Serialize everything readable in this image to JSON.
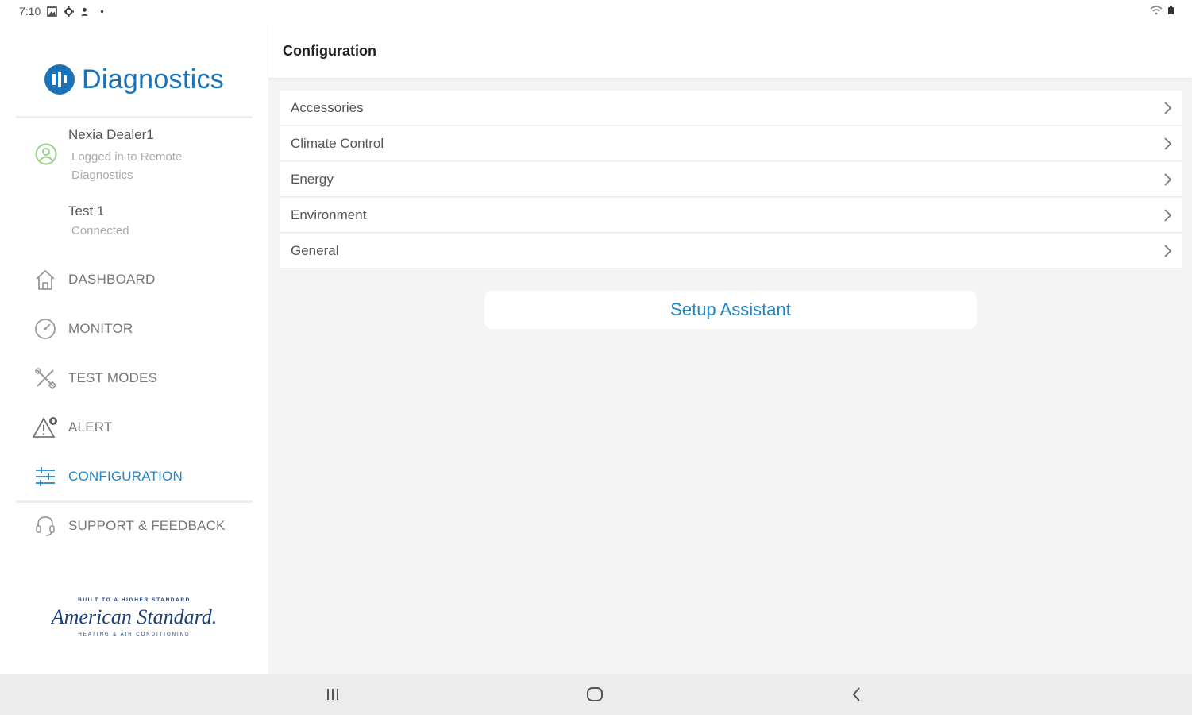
{
  "status_bar": {
    "time": "7:10",
    "left_icons": [
      "gallery-icon",
      "settings-icon",
      "person-alert-icon",
      "dot-icon"
    ],
    "right_icons": [
      "wifi-icon",
      "battery-icon"
    ]
  },
  "sidebar": {
    "brand": "Diagnostics",
    "user": {
      "name": "Nexia Dealer1",
      "status": "Logged in to Remote Diagnostics"
    },
    "device": {
      "name": "Test 1",
      "status": "Connected"
    },
    "nav": [
      {
        "label": "DASHBOARD",
        "icon": "home-icon",
        "active": false
      },
      {
        "label": "MONITOR",
        "icon": "gauge-icon",
        "active": false
      },
      {
        "label": "TEST MODES",
        "icon": "tools-icon",
        "active": false
      },
      {
        "label": "ALERT",
        "icon": "alert-icon",
        "active": false
      },
      {
        "label": "CONFIGURATION",
        "icon": "sliders-icon",
        "active": true
      },
      {
        "label": "SUPPORT & FEEDBACK",
        "icon": "headset-icon",
        "active": false
      }
    ],
    "logo": {
      "tagline": "BUILT TO A HIGHER STANDARD",
      "name": "American Standard.",
      "subline": "HEATING & AIR CONDITIONING"
    }
  },
  "main": {
    "title": "Configuration",
    "items": [
      {
        "label": "Accessories"
      },
      {
        "label": "Climate Control"
      },
      {
        "label": "Energy"
      },
      {
        "label": "Environment"
      },
      {
        "label": "General"
      }
    ],
    "setup_button": "Setup Assistant"
  },
  "colors": {
    "accent": "#1f87c9",
    "brand": "#1a73b8",
    "background": "#f4f4f4"
  },
  "navbar": {
    "buttons": [
      "recents-icon",
      "home-circle-icon",
      "back-icon"
    ]
  }
}
